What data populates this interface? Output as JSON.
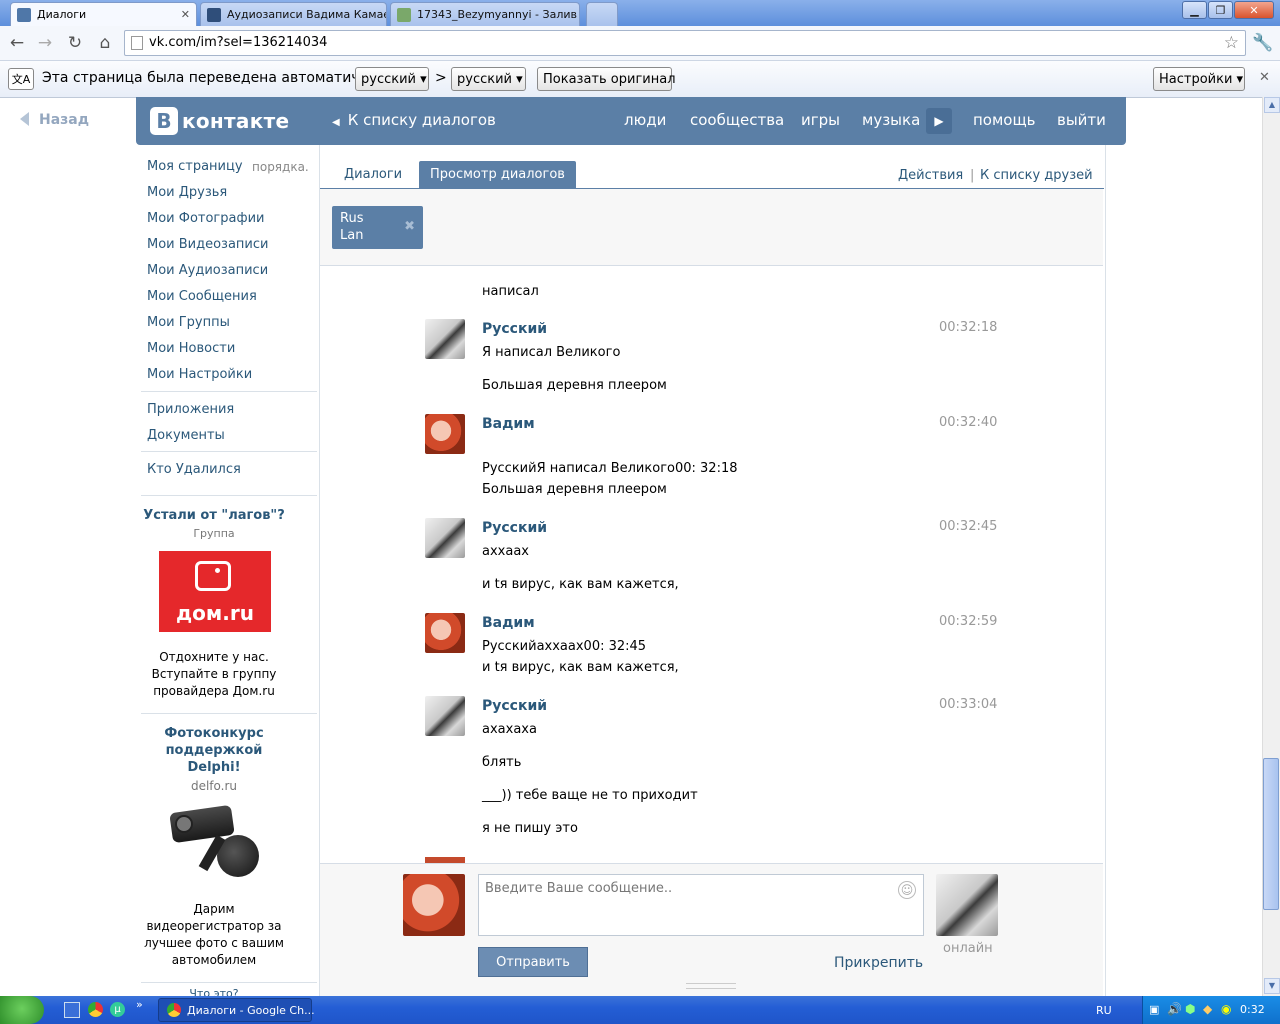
{
  "browser": {
    "tabs": [
      {
        "title": "Диалоги",
        "active": true
      },
      {
        "title": "Аудиозаписи Вадима Камае",
        "active": false
      },
      {
        "title": "17343_Bezymyannyi - Залив",
        "active": false
      }
    ],
    "url": "vk.com/im?sel=136214034",
    "translate_bar": {
      "text": "Эта страница была переведена автоматически",
      "from_lang": "русский ▾",
      "arrow": ">",
      "to_lang": "русский ▾",
      "show_original": "Показать оригинал",
      "settings": "Настройки ▾",
      "close": "✕"
    }
  },
  "vk": {
    "back_label": "Назад",
    "logo_letter": "В",
    "logo_word": "контакте",
    "to_dialogs": "К списку диалогов",
    "nav": [
      "люди",
      "сообщества",
      "игры",
      "музыка",
      "помощь",
      "выйти"
    ],
    "sidebar": {
      "items": [
        "Моя страницу",
        "Мои Друзья",
        "Мои Фотографии",
        "Мои Видеозаписи",
        "Мои Аудиозаписи",
        "Мои Сообщения",
        "Мои Группы",
        "Мои Новости",
        "Мои Настройки"
      ],
      "aside": "порядка.",
      "items2": [
        "Приложения",
        "Документы"
      ],
      "items3": [
        "Кто Удалился"
      ]
    },
    "ads": [
      {
        "title": "Устали от \"лагов\"?",
        "sub": "Группа",
        "logo": "дом.ru",
        "text": [
          "Отдохните у нас.",
          "Вступайте в группу",
          "провайдера Дом.ru"
        ]
      },
      {
        "title": [
          "Фотоконкурс",
          "поддержкой",
          "Delphi!"
        ],
        "sub": "delfo.ru",
        "text": [
          "Дарим",
          "видеорегистратор за",
          "лучшее фото с вашим",
          "автомобилем"
        ],
        "more": "Что это?"
      }
    ],
    "tabs": {
      "dialogs": "Диалоги",
      "view": "Просмотр диалогов",
      "actions": "Действия",
      "sep": "|",
      "friends": "К списку друзей"
    },
    "peer": {
      "line1": "Rus",
      "line2": "Lan",
      "close": "✖"
    },
    "messages": {
      "top_text": "написал",
      "groups": [
        {
          "author": "Русский",
          "time": "00:32:18",
          "lines": [
            "Я написал Великого",
            "Большая деревня плеером"
          ]
        },
        {
          "author": "Вадим",
          "time": "00:32:40",
          "lines": [
            "РусскийЯ написал Великого00: 32:18",
            "Большая деревня плеером"
          ]
        },
        {
          "author": "Русский",
          "time": "00:32:45",
          "lines": [
            "аххаах",
            "и tя вирус, как вам кажется,"
          ]
        },
        {
          "author": "Вадим",
          "time": "00:32:59",
          "lines": [
            "Русскийаххаах00: 32:45",
            "и tя вирус, как вам кажется,"
          ]
        },
        {
          "author": "Русский",
          "time": "00:33:04",
          "lines": [
            "ахахаха",
            "блять",
            "___)) тебе ваще не то приходит",
            "я не пишу это"
          ]
        }
      ]
    },
    "composer": {
      "placeholder": "Введите Ваше сообщение..",
      "send": "Отправить",
      "attach": "Прикрепить",
      "status": "онлайн"
    }
  },
  "taskbar": {
    "item": "Диалоги - Google Ch...",
    "lang": "RU",
    "clock": "0:32"
  }
}
